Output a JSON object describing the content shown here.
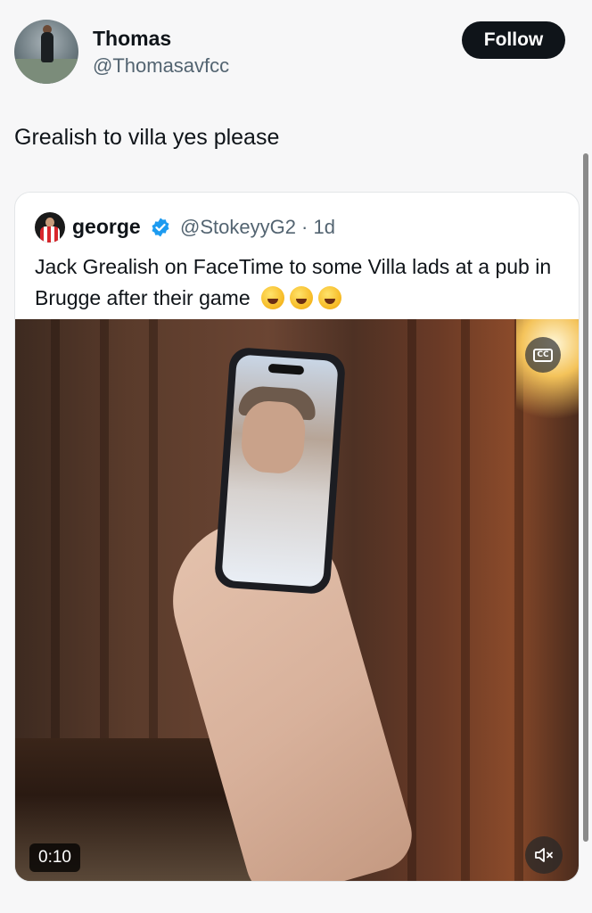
{
  "author": {
    "name": "Thomas",
    "handle": "@Thomasavfcc",
    "follow_label": "Follow"
  },
  "tweet": {
    "text": "Grealish to villa yes please"
  },
  "quoted": {
    "name": "george",
    "handle_time": "@StokeyyG2 · 1d",
    "text": "Jack Grealish on FaceTime to some Villa lads at a pub in Brugge after their game",
    "emojis": [
      "rolling-on-floor-laughing",
      "rolling-on-floor-laughing",
      "rolling-on-floor-laughing"
    ],
    "verified_color": "#1d9bf0"
  },
  "video": {
    "timestamp": "0:10",
    "cc_label": "CC"
  },
  "colors": {
    "follow_bg": "#0f1419",
    "secondary_text": "#536471"
  }
}
